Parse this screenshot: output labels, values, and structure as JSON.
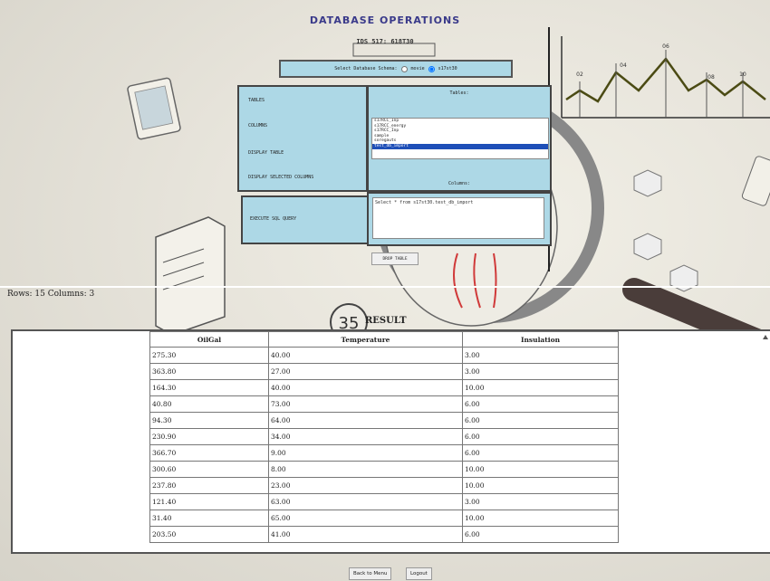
{
  "header": {
    "title": "DATABASE OPERATIONS",
    "subtitle": "IDS 517: 618T30"
  },
  "schema_selector": {
    "label": "Select Database Schema:",
    "options": [
      "movie",
      "s17st30"
    ],
    "selected": "s17st30"
  },
  "operations": {
    "tables": "TABLES",
    "columns": "COLUMNS",
    "display_table": "DISPLAY TABLE",
    "display_selected_columns": "DISPLAY SELECTED COLUMNS",
    "execute_sql": "EXECUTE SQL QUERY",
    "drop_table": "DROP TABLE"
  },
  "tables_panel": {
    "tables_label": "Tables:",
    "columns_label": "Columns:",
    "items": [
      "s17RCC_Inp",
      "s17RCC_energy",
      "s17RCC_Inp",
      "sample",
      "soregauts",
      "test_db_import"
    ],
    "selected_index": 5
  },
  "query": {
    "text": "Select * from s17st30.test_db_import"
  },
  "result": {
    "rows_cols_text": "Rows: 15  Columns: 3",
    "label": "RESULT",
    "columns": [
      "OilGal",
      "Temperature",
      "Insulation"
    ],
    "rows": [
      [
        "275.30",
        "40.00",
        "3.00"
      ],
      [
        "363.80",
        "27.00",
        "3.00"
      ],
      [
        "164.30",
        "40.00",
        "10.00"
      ],
      [
        "40.80",
        "73.00",
        "6.00"
      ],
      [
        "94.30",
        "64.00",
        "6.00"
      ],
      [
        "230.90",
        "34.00",
        "6.00"
      ],
      [
        "366.70",
        "9.00",
        "6.00"
      ],
      [
        "300.60",
        "8.00",
        "10.00"
      ],
      [
        "237.80",
        "23.00",
        "10.00"
      ],
      [
        "121.40",
        "63.00",
        "3.00"
      ],
      [
        "31.40",
        "65.00",
        "10.00"
      ],
      [
        "203.50",
        "41.00",
        "6.00"
      ]
    ]
  },
  "footer": {
    "back_label": "Back to Menu",
    "logout_label": "Logout"
  },
  "chart_labels": [
    "02",
    "04",
    "06",
    "08",
    "10"
  ],
  "colors": {
    "panel_bg": "#add8e6",
    "title_color": "#3a3a8a",
    "selection": "#1e4fb8"
  }
}
